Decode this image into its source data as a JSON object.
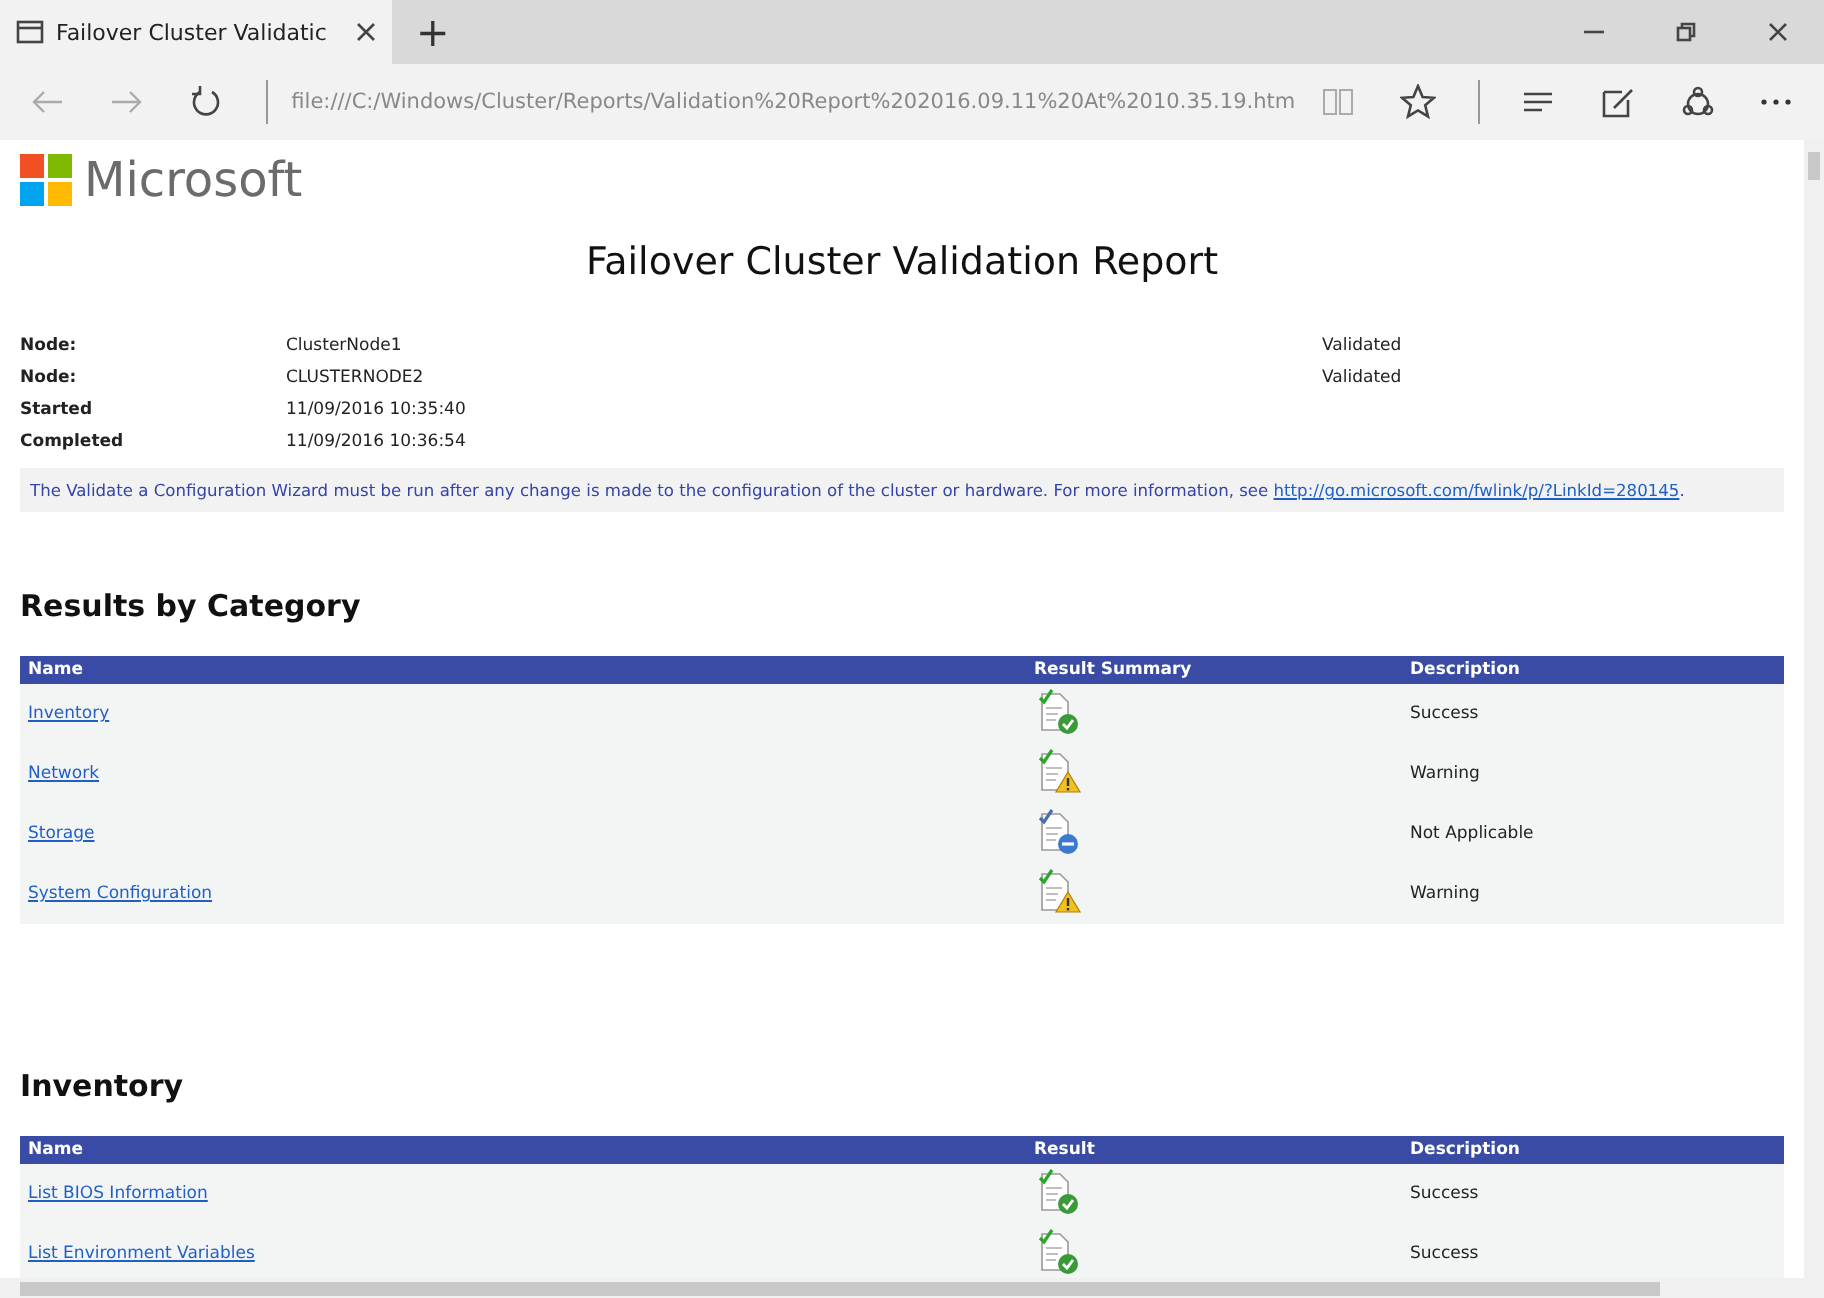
{
  "browser": {
    "tab": {
      "title": "Failover Cluster Validatic",
      "selected": true
    },
    "new_tab": "+",
    "address": "file:///C:/Windows/Cluster/Reports/Validation%20Report%202016.09.11%20At%2010.35.19.htm"
  },
  "page": {
    "logo": "Microsoft",
    "title": "Failover Cluster Validation Report",
    "summary": [
      {
        "label": "Node:",
        "value": "ClusterNode1",
        "status": "Validated"
      },
      {
        "label": "Node:",
        "value": "CLUSTERNODE2",
        "status": "Validated"
      },
      {
        "label": "Started",
        "value": "11/09/2016 10:35:40"
      },
      {
        "label": "Completed",
        "value": "11/09/2016 10:36:54"
      }
    ],
    "notice": {
      "text": "The Validate a Configuration Wizard must be run after any change is made to the configuration of the cluster or hardware. For more information, see ",
      "link": "http://go.microsoft.com/fwlink/p/?LinkId=280145",
      "end": "."
    },
    "sections": [
      {
        "heading": "Results by Category",
        "columns": [
          "Name",
          "Result Summary",
          "Description"
        ],
        "rows": [
          {
            "name": "Inventory",
            "kind": "success",
            "description": "Success"
          },
          {
            "name": "Network",
            "kind": "warning",
            "description": "Warning"
          },
          {
            "name": "Storage",
            "kind": "na",
            "description": "Not Applicable"
          },
          {
            "name": "System Configuration",
            "kind": "warning",
            "description": "Warning"
          }
        ]
      },
      {
        "heading": "Inventory",
        "columns": [
          "Name",
          "Result",
          "Description"
        ],
        "rows": [
          {
            "name": "List BIOS Information",
            "kind": "success",
            "description": "Success"
          },
          {
            "name": "List Environment Variables",
            "kind": "success",
            "description": "Success"
          }
        ]
      }
    ]
  }
}
